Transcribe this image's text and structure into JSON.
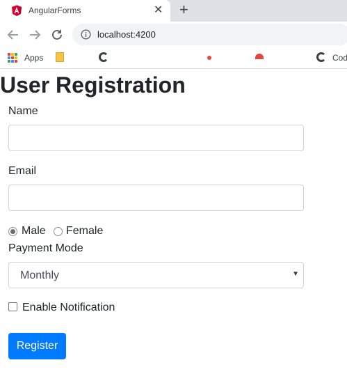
{
  "browser": {
    "tab_title": "AngularForms",
    "tab_close": "✕",
    "new_tab": "+",
    "url": "localhost:4200",
    "bookmarks": {
      "apps_label": "Apps",
      "last_label": "Cod"
    }
  },
  "form": {
    "title": "User Registration",
    "name_label": "Name",
    "name_value": "",
    "email_label": "Email",
    "email_value": "",
    "gender_options": [
      "Male",
      "Female"
    ],
    "gender_selected": "Male",
    "payment_label": "Payment Mode",
    "payment_selected": "Monthly",
    "notification_label": "Enable Notification",
    "notification_checked": false,
    "submit_label": "Register"
  },
  "colors": {
    "primary": "#007bff",
    "angular_red": "#dd0031",
    "apps_grid": [
      "#ea4335",
      "#fbbc05",
      "#34a853",
      "#4285f4",
      "#ea4335",
      "#fbbc05",
      "#34a853",
      "#4285f4",
      "#ea4335"
    ]
  }
}
